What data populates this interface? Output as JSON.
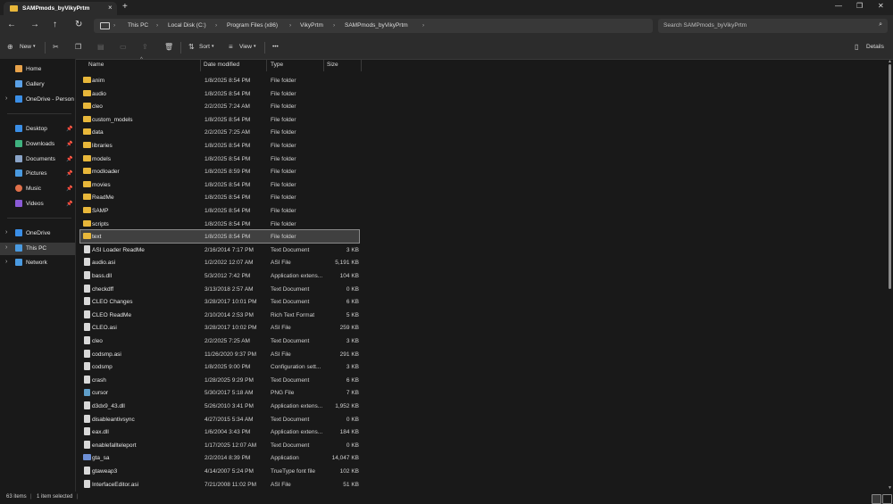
{
  "window": {
    "tab_title": "SAMPmods_byVikyPrtm",
    "tab_close": "×",
    "new_tab": "+",
    "minimize": "—",
    "maximize": "❐",
    "close": "✕"
  },
  "address": {
    "crumbs": [
      "This PC",
      "Local Disk (C:)",
      "Program Files (x86)",
      "VikyPrtm",
      "SAMPmods_byVikyPrtm"
    ],
    "separator": "›",
    "search_placeholder": "Search SAMPmods_byVikyPrtm"
  },
  "commands": {
    "new": "New",
    "sort": "Sort",
    "view": "View",
    "more": "•••",
    "details": "Details"
  },
  "sidebar": {
    "items": [
      {
        "label": "Home",
        "icon": "home-icon",
        "color": "#e8a24a"
      },
      {
        "label": "Gallery",
        "icon": "gallery-icon",
        "color": "#5aa0e6"
      },
      {
        "label": "OneDrive - Persona",
        "icon": "cloud-icon",
        "color": "#3a8ee6"
      },
      {
        "label": "Desktop",
        "icon": "desktop-icon",
        "color": "#3a8ee6"
      },
      {
        "label": "Downloads",
        "icon": "download-icon",
        "color": "#3fb27f"
      },
      {
        "label": "Documents",
        "icon": "document-icon",
        "color": "#8aa4c8"
      },
      {
        "label": "Pictures",
        "icon": "pictures-icon",
        "color": "#4a9ae0"
      },
      {
        "label": "Music",
        "icon": "music-icon",
        "color": "#e0704a"
      },
      {
        "label": "Videos",
        "icon": "videos-icon",
        "color": "#8a5ad6"
      },
      {
        "label": "OneDrive",
        "icon": "cloud-icon",
        "color": "#3a8ee6"
      },
      {
        "label": "This PC",
        "icon": "pc-icon",
        "color": "#4a9ae0"
      },
      {
        "label": "Network",
        "icon": "network-icon",
        "color": "#4a9ae0"
      }
    ]
  },
  "columns": {
    "name": "Name",
    "date": "Date modified",
    "type": "Type",
    "size": "Size"
  },
  "files": [
    {
      "name": "anim",
      "date": "1/8/2025 8:54 PM",
      "type": "File folder",
      "size": "",
      "kind": "folder"
    },
    {
      "name": "audio",
      "date": "1/8/2025 8:54 PM",
      "type": "File folder",
      "size": "",
      "kind": "folder"
    },
    {
      "name": "cleo",
      "date": "2/2/2025 7:24 AM",
      "type": "File folder",
      "size": "",
      "kind": "folder"
    },
    {
      "name": "custom_models",
      "date": "1/8/2025 8:54 PM",
      "type": "File folder",
      "size": "",
      "kind": "folder"
    },
    {
      "name": "data",
      "date": "2/2/2025 7:25 AM",
      "type": "File folder",
      "size": "",
      "kind": "folder"
    },
    {
      "name": "libraries",
      "date": "1/8/2025 8:54 PM",
      "type": "File folder",
      "size": "",
      "kind": "folder"
    },
    {
      "name": "models",
      "date": "1/8/2025 8:54 PM",
      "type": "File folder",
      "size": "",
      "kind": "folder"
    },
    {
      "name": "modloader",
      "date": "1/8/2025 8:59 PM",
      "type": "File folder",
      "size": "",
      "kind": "folder"
    },
    {
      "name": "movies",
      "date": "1/8/2025 8:54 PM",
      "type": "File folder",
      "size": "",
      "kind": "folder"
    },
    {
      "name": "ReadMe",
      "date": "1/8/2025 8:54 PM",
      "type": "File folder",
      "size": "",
      "kind": "folder"
    },
    {
      "name": "SAMP",
      "date": "1/8/2025 8:54 PM",
      "type": "File folder",
      "size": "",
      "kind": "folder"
    },
    {
      "name": "scripts",
      "date": "1/8/2025 8:54 PM",
      "type": "File folder",
      "size": "",
      "kind": "folder"
    },
    {
      "name": "text",
      "date": "1/8/2025 8:54 PM",
      "type": "File folder",
      "size": "",
      "kind": "folder",
      "selected": true
    },
    {
      "name": "ASI Loader ReadMe",
      "date": "2/16/2014 7:17 PM",
      "type": "Text Document",
      "size": "3 KB",
      "kind": "file"
    },
    {
      "name": "audio.asi",
      "date": "1/2/2022 12:07 AM",
      "type": "ASI File",
      "size": "5,191 KB",
      "kind": "file"
    },
    {
      "name": "bass.dll",
      "date": "5/3/2012 7:42 PM",
      "type": "Application extens...",
      "size": "104 KB",
      "kind": "file"
    },
    {
      "name": "checkdff",
      "date": "3/13/2018 2:57 AM",
      "type": "Text Document",
      "size": "0 KB",
      "kind": "file"
    },
    {
      "name": "CLEO Changes",
      "date": "3/28/2017 10:01 PM",
      "type": "Text Document",
      "size": "6 KB",
      "kind": "file"
    },
    {
      "name": "CLEO ReadMe",
      "date": "2/10/2014 2:53 PM",
      "type": "Rich Text Format",
      "size": "5 KB",
      "kind": "file"
    },
    {
      "name": "CLEO.asi",
      "date": "3/28/2017 10:02 PM",
      "type": "ASI File",
      "size": "259 KB",
      "kind": "file"
    },
    {
      "name": "cleo",
      "date": "2/2/2025 7:25 AM",
      "type": "Text Document",
      "size": "3 KB",
      "kind": "file"
    },
    {
      "name": "codsmp.asi",
      "date": "11/26/2020 9:37 PM",
      "type": "ASI File",
      "size": "291 KB",
      "kind": "file"
    },
    {
      "name": "codsmp",
      "date": "1/8/2025 9:00 PM",
      "type": "Configuration sett...",
      "size": "3 KB",
      "kind": "file"
    },
    {
      "name": "crash",
      "date": "1/28/2025 9:29 PM",
      "type": "Text Document",
      "size": "6 KB",
      "kind": "file"
    },
    {
      "name": "cursor",
      "date": "5/30/2017 5:18 AM",
      "type": "PNG File",
      "size": "7 KB",
      "kind": "img"
    },
    {
      "name": "d3dx9_43.dll",
      "date": "5/26/2010 3:41 PM",
      "type": "Application extens...",
      "size": "1,952 KB",
      "kind": "file"
    },
    {
      "name": "disableantivsync",
      "date": "4/27/2015 5:34 AM",
      "type": "Text Document",
      "size": "0 KB",
      "kind": "file"
    },
    {
      "name": "eax.dll",
      "date": "1/6/2004 3:43 PM",
      "type": "Application extens...",
      "size": "184 KB",
      "kind": "file"
    },
    {
      "name": "enablefallteleport",
      "date": "1/17/2025 12:07 AM",
      "type": "Text Document",
      "size": "0 KB",
      "kind": "file"
    },
    {
      "name": "gta_sa",
      "date": "2/2/2014 8:39 PM",
      "type": "Application",
      "size": "14,047 KB",
      "kind": "exe"
    },
    {
      "name": "gtaweap3",
      "date": "4/14/2007 5:24 PM",
      "type": "TrueType font file",
      "size": "102 KB",
      "kind": "file"
    },
    {
      "name": "InterfaceEditor.asi",
      "date": "7/21/2008 11:02 PM",
      "type": "ASI File",
      "size": "51 KB",
      "kind": "file"
    }
  ],
  "status": {
    "count": "63 items",
    "selected": "1 item selected"
  }
}
